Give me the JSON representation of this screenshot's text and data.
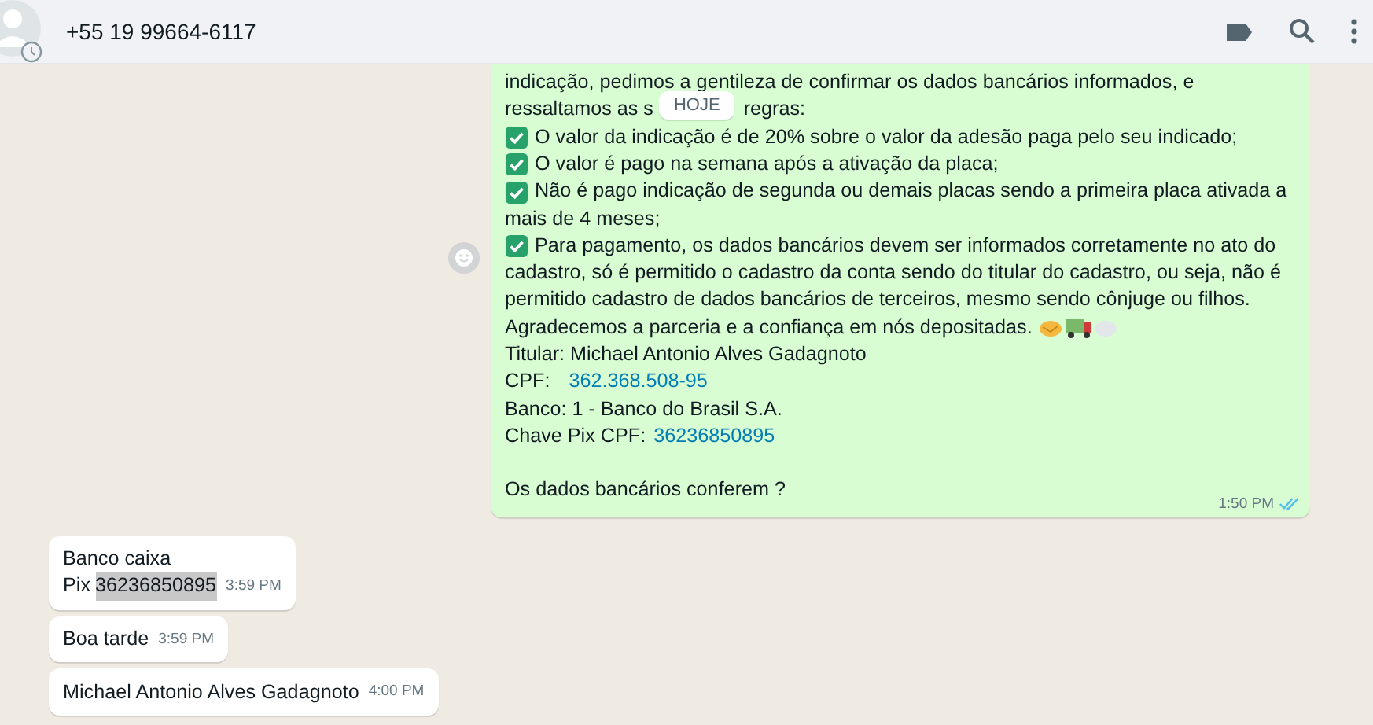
{
  "header": {
    "contact": "+55 19 99664-6117"
  },
  "date_chip": "HOJE",
  "messages": [
    {
      "outgoing": true,
      "time": "1:50 PM",
      "read": true,
      "lines": [
        {
          "kind": "text",
          "text": "indicação, pedimos a gentileza de confirmar os dados bancários informados, e"
        },
        {
          "kind": "split",
          "before": "ressaltamos as s",
          "after": "regras:"
        },
        {
          "kind": "check",
          "text": "O valor da indicação é de 20% sobre o valor da adesão paga pelo seu indicado;"
        },
        {
          "kind": "check",
          "text": "O valor é pago na semana após a ativação da placa;"
        },
        {
          "kind": "check",
          "text": "Não é pago indicação de segunda ou demais placas sendo a primeira placa ativada a"
        },
        {
          "kind": "text",
          "text": "mais de 4 meses;"
        },
        {
          "kind": "check",
          "text": "Para pagamento, os dados bancários devem ser informados corretamente no ato do"
        },
        {
          "kind": "text",
          "text": "cadastro, só é permitido o cadastro da conta sendo do titular do cadastro, ou seja, não é"
        },
        {
          "kind": "text",
          "text": "permitido cadastro de dados bancários de terceiros, mesmo sendo cônjuge ou filhos."
        },
        {
          "kind": "emoji",
          "text": "Agradecemos a parceria e a confiança em nós depositadas."
        },
        {
          "kind": "text",
          "text": "Titular: Michael Antonio Alves Gadagnoto"
        },
        {
          "kind": "field",
          "label": "CPF:",
          "value": "362.368.508-95"
        },
        {
          "kind": "text",
          "text": "Banco: 1 - Banco do Brasil S.A."
        },
        {
          "kind": "field",
          "label": "Chave Pix CPF:",
          "value": "36236850895"
        },
        {
          "kind": "blank"
        },
        {
          "kind": "text",
          "text": "Os dados bancários conferem ?"
        }
      ]
    },
    {
      "outgoing": false,
      "time": "3:59 PM",
      "lines": [
        {
          "kind": "text",
          "text": "Banco caixa"
        },
        {
          "kind": "selected",
          "label": "Pix",
          "value": "36236850895"
        }
      ]
    },
    {
      "outgoing": false,
      "time": "3:59 PM",
      "lines": [
        {
          "kind": "text",
          "text": "Boa tarde"
        }
      ]
    },
    {
      "outgoing": false,
      "time": "4:00 PM",
      "lines": [
        {
          "kind": "text",
          "text": "Michael Antonio Alves Gadagnoto"
        }
      ]
    }
  ]
}
